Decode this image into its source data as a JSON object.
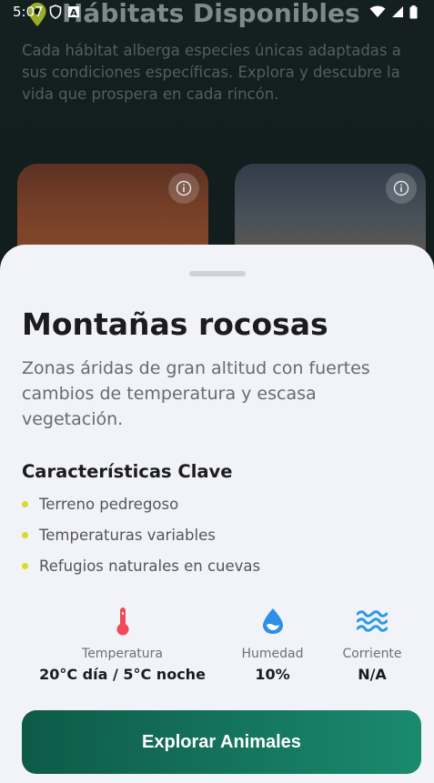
{
  "status_bar": {
    "time": "5:07"
  },
  "background": {
    "title": "Hábitats Disponibles",
    "description": "Cada hábitat alberga especies únicas adaptadas a sus condiciones específicas. Explora y descubre la vida que prospera en cada rincón."
  },
  "sheet": {
    "title": "Montañas rocosas",
    "description": "Zonas áridas de gran altitud con fuertes cambios de temperatura y escasa vegetación.",
    "features_title": "Características Clave",
    "features": [
      "Terreno pedregoso",
      "Temperaturas variables",
      "Refugios naturales en cuevas"
    ],
    "stats": {
      "temperature": {
        "label": "Temperatura",
        "value": "20°C día / 5°C noche",
        "icon": "thermometer-icon"
      },
      "humidity": {
        "label": "Humedad",
        "value": "10%",
        "icon": "water-drop-icon"
      },
      "current": {
        "label": "Corriente",
        "value": "N/A",
        "icon": "waves-icon"
      }
    },
    "cta_label": "Explorar Animales"
  },
  "colors": {
    "accent_bullet": "#d6dc1f",
    "cta_start": "#0e5a49",
    "cta_end": "#1a8a6f",
    "thermometer": "#f04a5a",
    "water": "#2e8fe6"
  }
}
